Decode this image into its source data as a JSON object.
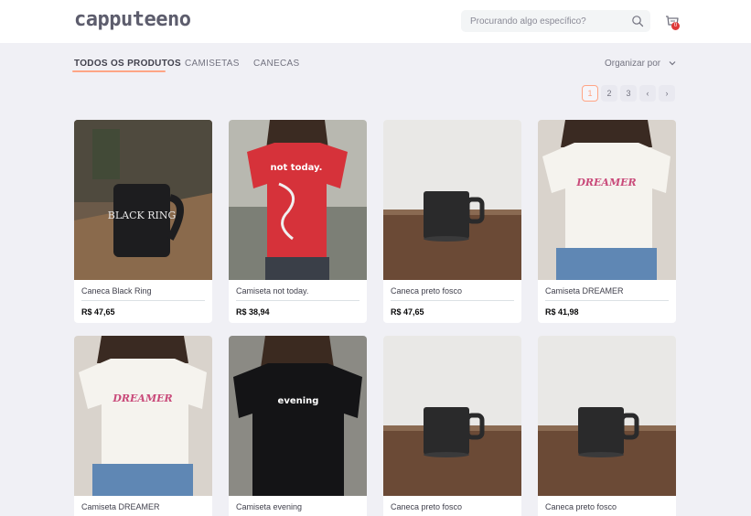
{
  "header": {
    "logo": "capputeeno",
    "search_placeholder": "Procurando algo específico?",
    "cart_count": "0"
  },
  "tabs": [
    {
      "label": "TODOS OS PRODUTOS",
      "active": true
    },
    {
      "label": "CAMISETAS",
      "active": false
    },
    {
      "label": "CANECAS",
      "active": false
    }
  ],
  "sort": {
    "label": "Organizar por"
  },
  "pagination": {
    "pages": [
      "1",
      "2",
      "3"
    ],
    "current": "1",
    "prev": "‹",
    "next": "›"
  },
  "products": [
    {
      "name": "Caneca Black Ring",
      "price": "R$ 47,65",
      "image": "mug-black-ring"
    },
    {
      "name": "Camiseta not today.",
      "price": "R$ 38,94",
      "image": "tshirt-not-today"
    },
    {
      "name": "Caneca preto fosco",
      "price": "R$ 47,65",
      "image": "mug-matte-black"
    },
    {
      "name": "Camiseta DREAMER",
      "price": "R$ 41,98",
      "image": "tshirt-dreamer"
    },
    {
      "name": "Camiseta DREAMER",
      "price": "",
      "image": "tshirt-dreamer"
    },
    {
      "name": "Camiseta evening",
      "price": "",
      "image": "tshirt-evening"
    },
    {
      "name": "Caneca preto fosco",
      "price": "",
      "image": "mug-matte-black"
    },
    {
      "name": "Caneca preto fosco",
      "price": "",
      "image": "mug-matte-black"
    }
  ],
  "image_text": {
    "black_ring": "BLACK RING",
    "not_today": "not today.",
    "dreamer": "DREAMER",
    "evening": "evening"
  },
  "colors": {
    "accent": "#ffa585",
    "badge": "#de3838",
    "background": "#f0f0f5"
  }
}
